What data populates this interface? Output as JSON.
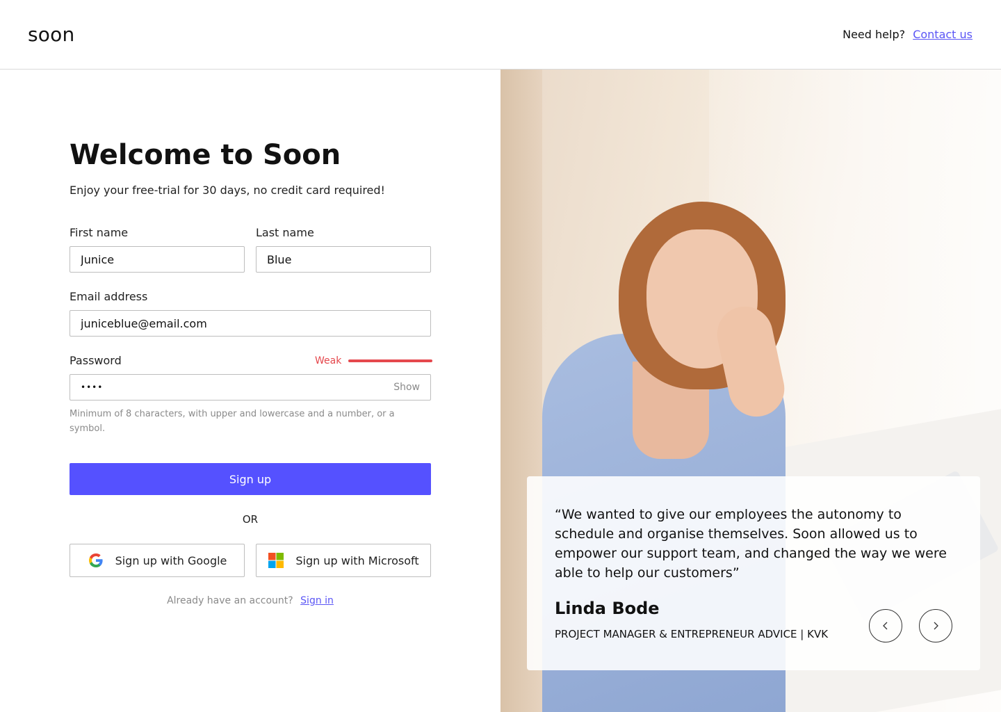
{
  "header": {
    "logo": "soon",
    "help_text": "Need help?",
    "contact_link": "Contact us"
  },
  "form": {
    "title": "Welcome to Soon",
    "subtitle": "Enjoy your free-trial for 30 days, no credit card required!",
    "first_name": {
      "label": "First name",
      "value": "Junice"
    },
    "last_name": {
      "label": "Last name",
      "value": "Blue"
    },
    "email": {
      "label": "Email address",
      "value": "juniceblue@email.com"
    },
    "password": {
      "label": "Password",
      "value": "••••",
      "strength_label": "Weak",
      "show_label": "Show",
      "hint": "Minimum of 8 characters, with upper and lowercase and a number, or a symbol."
    },
    "signup_label": "Sign up",
    "or_label": "OR",
    "google_label": "Sign up with Google",
    "microsoft_label": "Sign up with Microsoft",
    "signin_prompt": "Already have an account?",
    "signin_link": "Sign in"
  },
  "testimonial": {
    "quote": "“We wanted to give our employees the autonomy to schedule and organise themselves. Soon allowed us to empower our support team, and changed the way we were able to help our customers”",
    "name": "Linda Bode",
    "role": "PROJECT MANAGER & ENTREPRENEUR ADVICE | KVK"
  },
  "colors": {
    "accent": "#5551ff",
    "link": "#5a55f5",
    "weak": "#e5484d"
  }
}
